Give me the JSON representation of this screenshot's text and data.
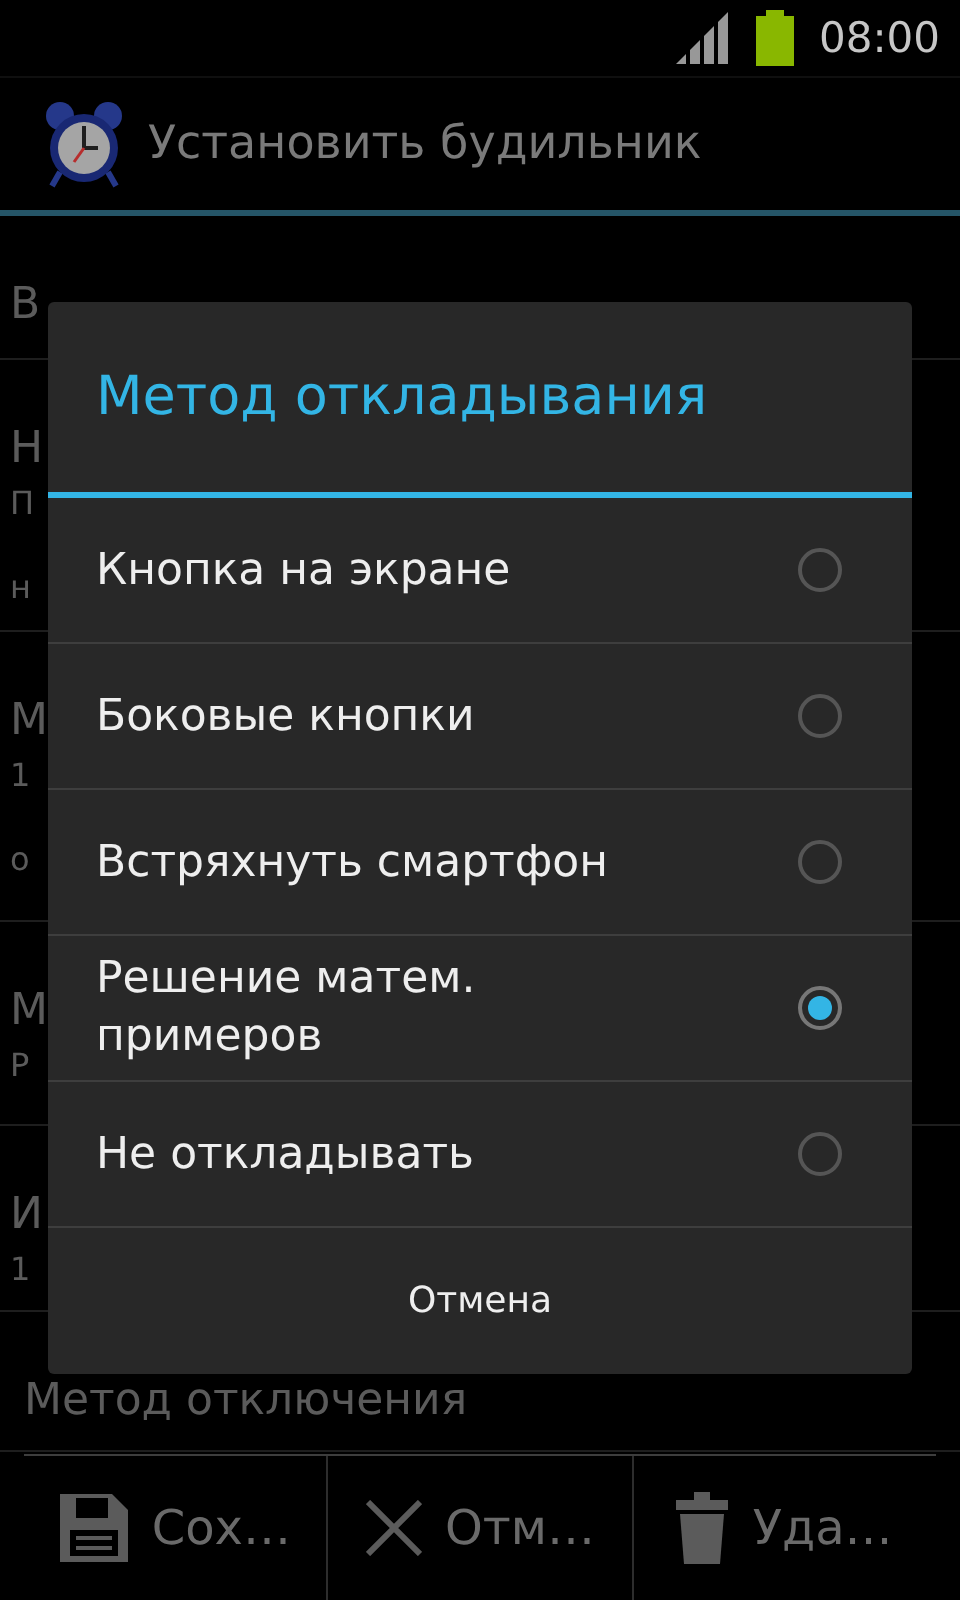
{
  "status_bar": {
    "time": "08:00"
  },
  "action_bar": {
    "title": "Установить будильник"
  },
  "settings": [
    {
      "title": "В"
    },
    {
      "title": "Н",
      "summary": "П",
      "extra": "н"
    },
    {
      "title": "М",
      "summary": "1",
      "extra": "о"
    },
    {
      "title": "М",
      "summary": "Р"
    },
    {
      "title": "И",
      "summary": "1"
    },
    {
      "title": "Метод отключения"
    }
  ],
  "dialog": {
    "title": "Метод откладывания",
    "options": [
      {
        "label": "Кнопка на экране",
        "selected": false
      },
      {
        "label": "Боковые кнопки",
        "selected": false
      },
      {
        "label": "Встряхнуть смартфон",
        "selected": false
      },
      {
        "label": "Решение матем. примеров",
        "selected": true
      },
      {
        "label": "Не откладывать",
        "selected": false
      }
    ],
    "cancel": "Отмена"
  },
  "bottom_bar": [
    {
      "kind": "save",
      "label": "Сох…"
    },
    {
      "kind": "cancel",
      "label": "Отм…"
    },
    {
      "kind": "delete",
      "label": "Уда…"
    }
  ]
}
